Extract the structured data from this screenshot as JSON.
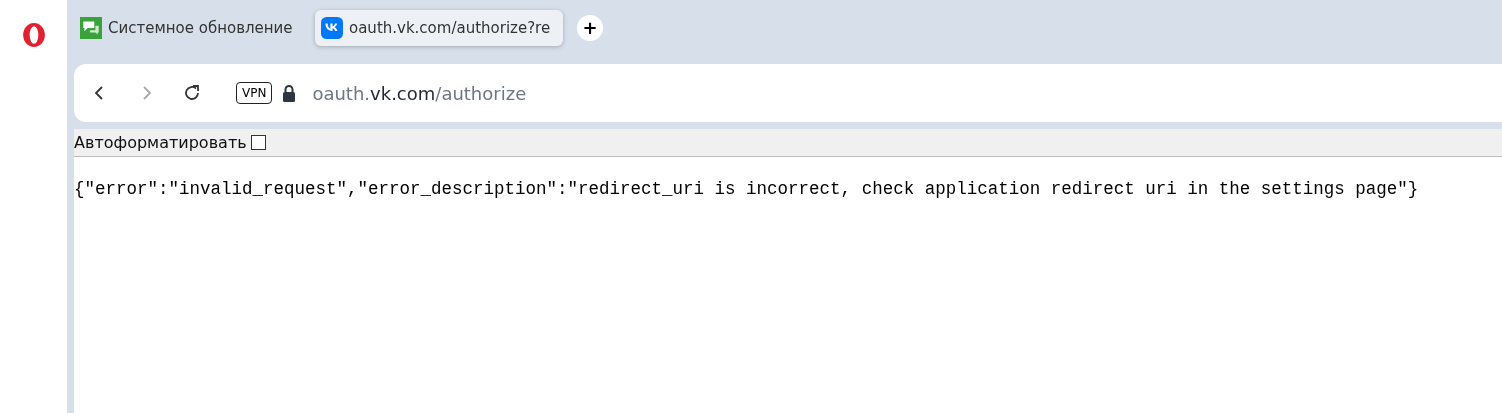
{
  "tabs": [
    {
      "title": "Системное обновление",
      "selected": false,
      "kind": "chat"
    },
    {
      "title": "oauth.vk.com/authorize?re",
      "selected": true,
      "kind": "vk"
    }
  ],
  "new_tab": "+",
  "address_bar": {
    "vpn": "VPN",
    "url": {
      "subdomain": "oauth.",
      "domain": "vk.com",
      "path": "/authorize"
    }
  },
  "autoformat": {
    "label": "Автоформатировать",
    "checked": false
  },
  "body": "{\"error\":\"invalid_request\",\"error_description\":\"redirect_uri is incorrect, check application redirect uri in the settings page\"}"
}
